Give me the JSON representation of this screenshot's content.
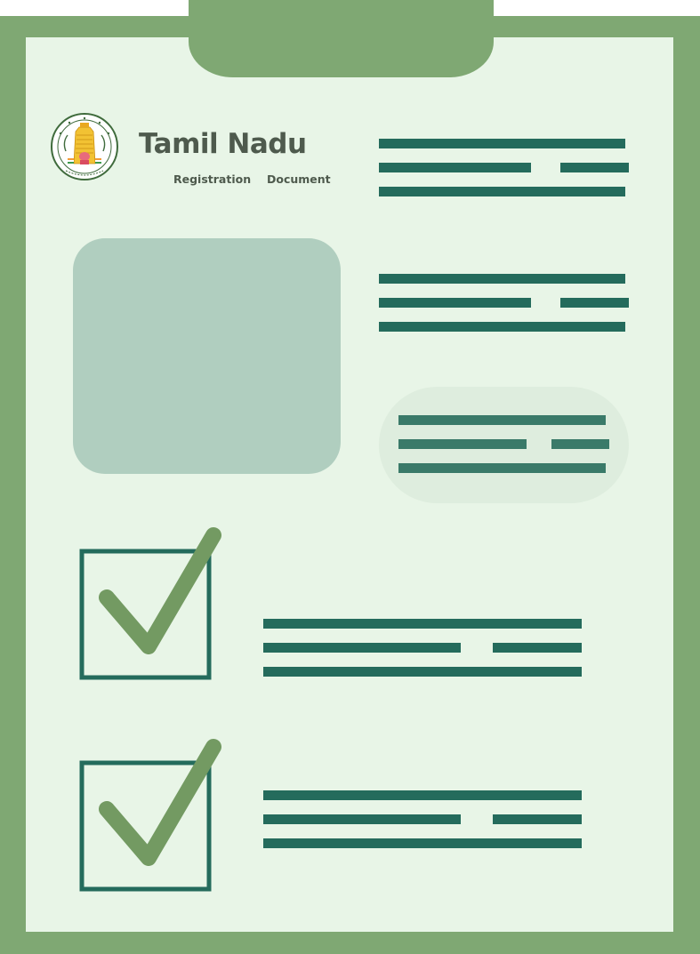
{
  "header": {
    "title": "Tamil Nadu",
    "subtitle_left": "Registration",
    "subtitle_right": "Document"
  },
  "emblem": {
    "icon": "tamil-nadu-emblem-icon"
  },
  "colors": {
    "frame": "#7fa873",
    "paper": "#e8f5e7",
    "lines": "#246b5c",
    "photo_placeholder": "#b0cebf",
    "checkmark": "#739a62",
    "checkbox_border": "#246b5c",
    "title_text": "#4e5a4d"
  },
  "checklist": [
    {
      "checked": true,
      "icon": "checkmark-icon"
    },
    {
      "checked": true,
      "icon": "checkmark-icon"
    }
  ]
}
